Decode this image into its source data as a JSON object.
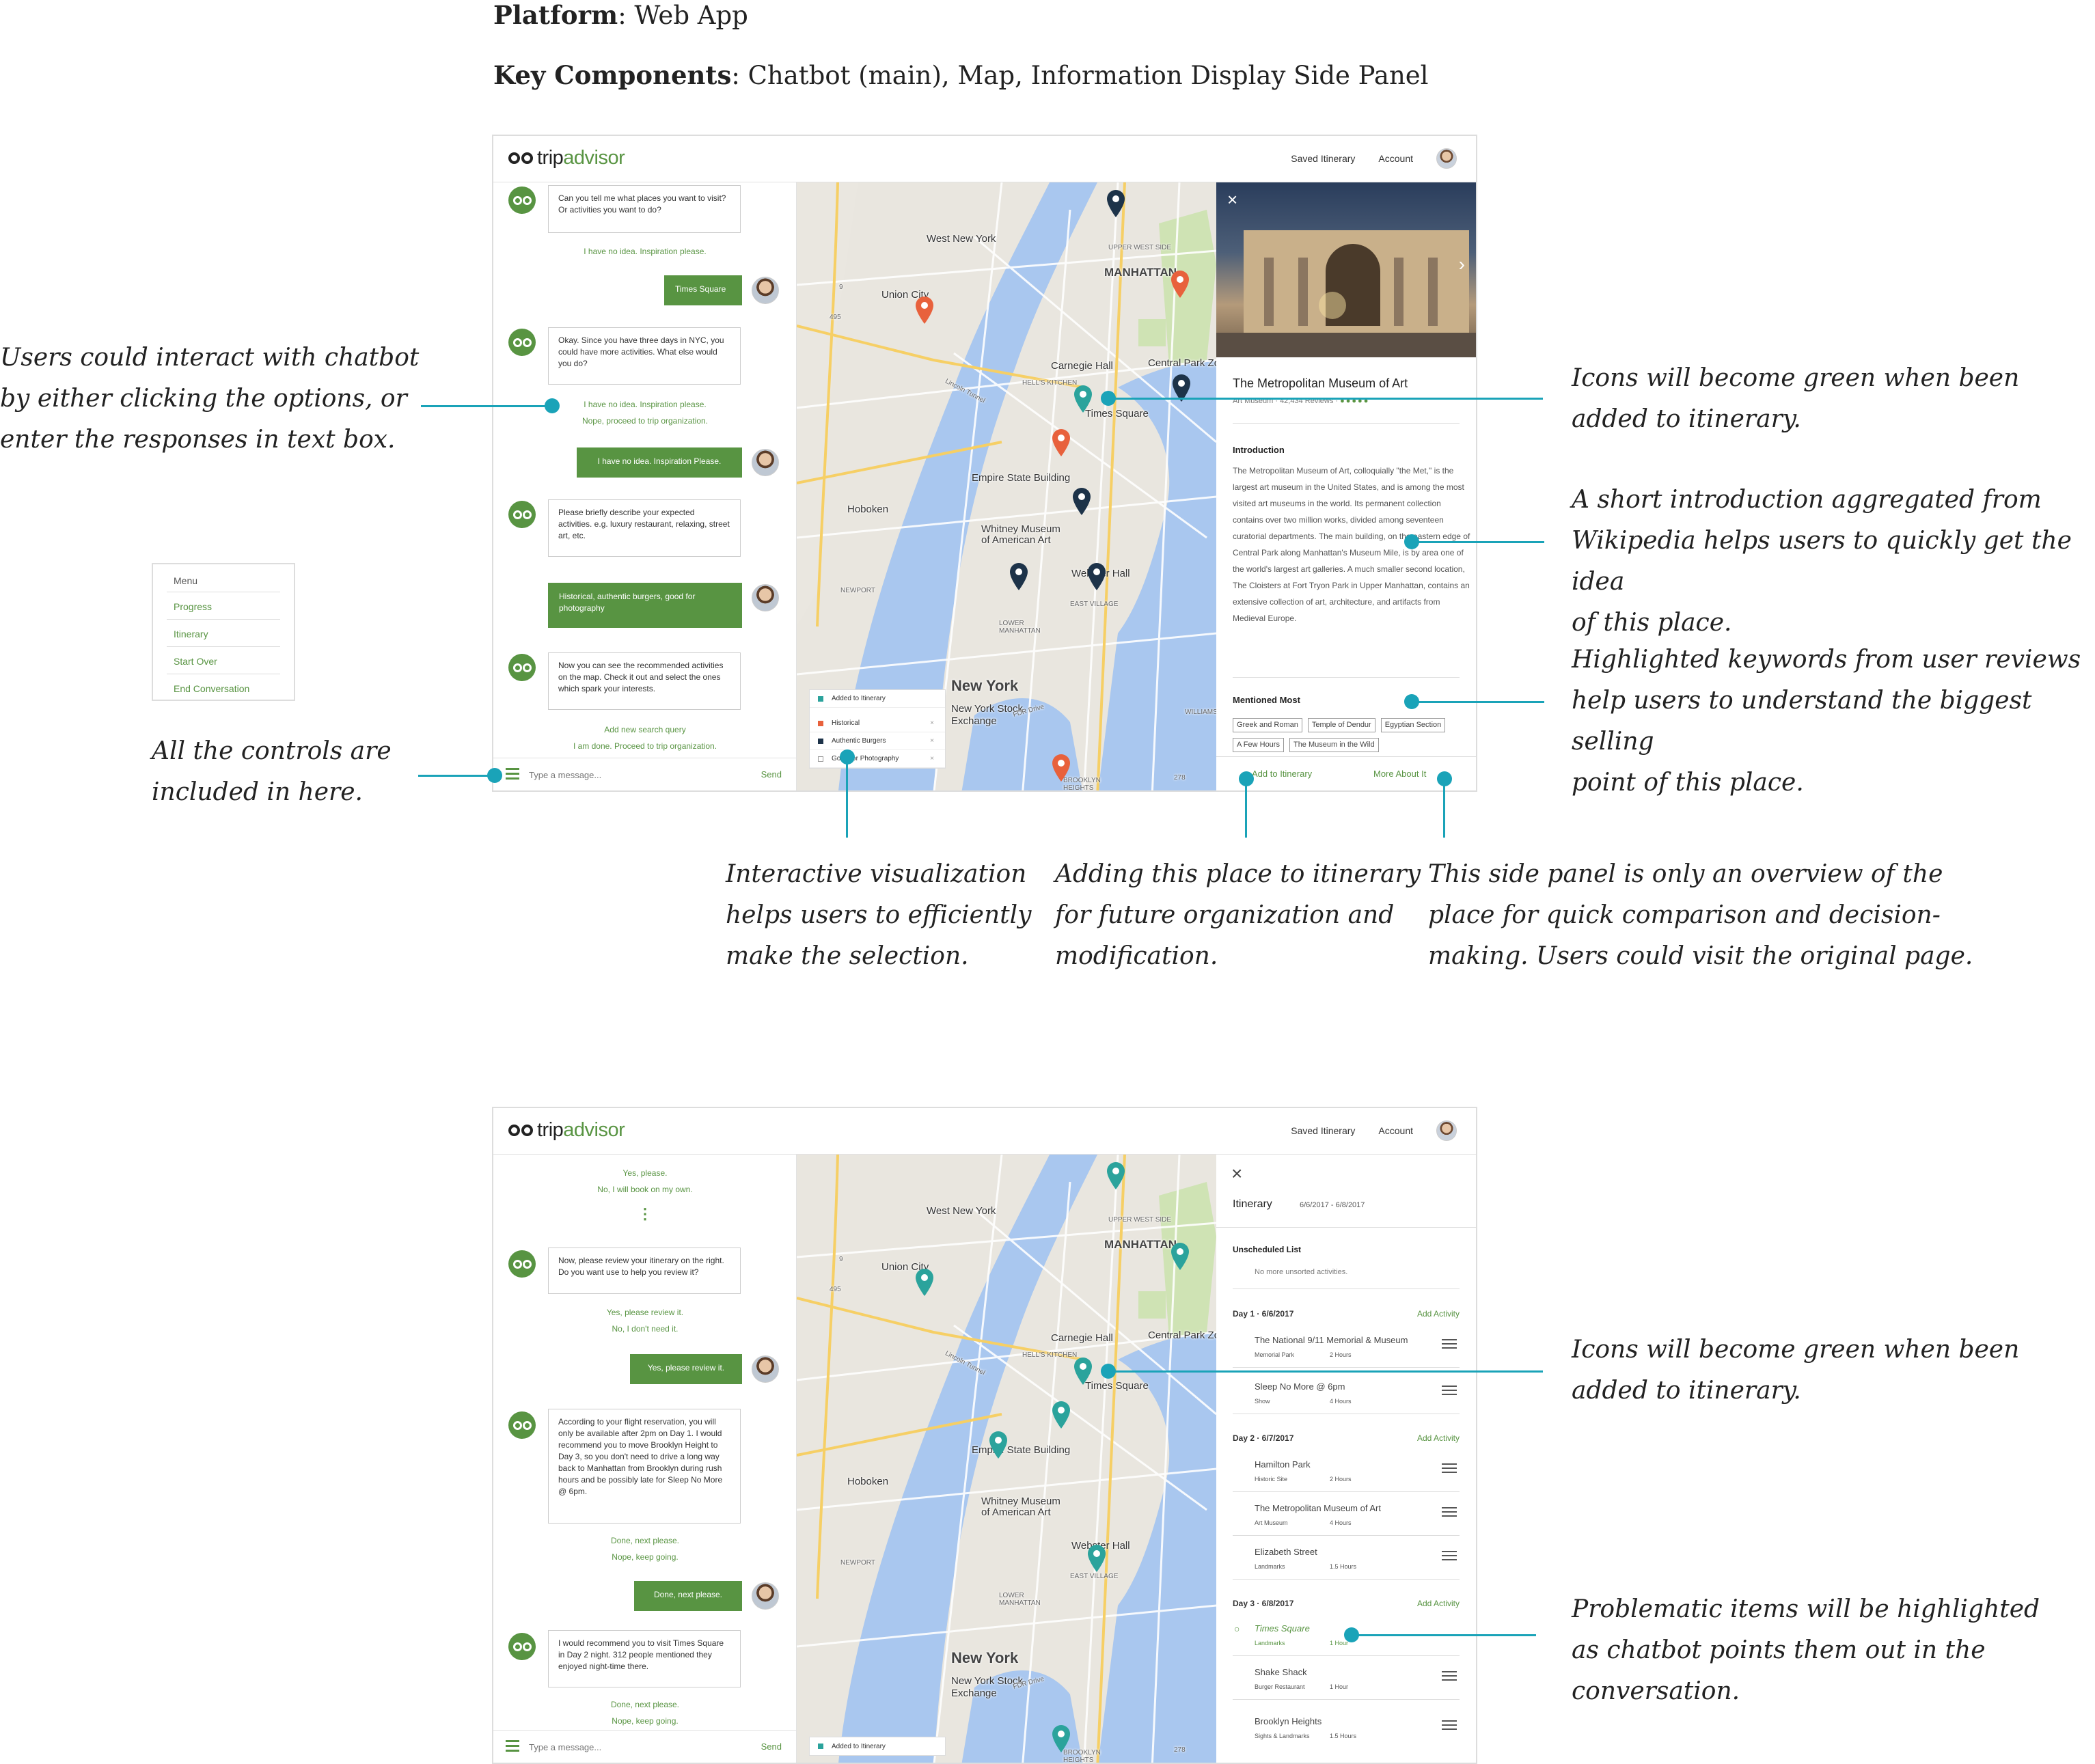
{
  "header": {
    "platform_label": "Platform",
    "platform_value": ": Web App",
    "components_label": "Key Components",
    "components_value": ": Chatbot (main), Map, Information Display Side Panel"
  },
  "annotations": {
    "chatbot": [
      "Users could interact with chatbot",
      "by either clicking the options, or",
      "enter the responses in text box."
    ],
    "controls": [
      "All the controls are",
      "included in here."
    ],
    "icons_green_1": [
      "Icons will become green when been",
      "added to itinerary."
    ],
    "intro": [
      "A short introduction aggregated from",
      "Wikipedia helps users to quickly get the idea",
      "of this place."
    ],
    "keywords": [
      "Highlighted keywords from user reviews",
      "help users to understand the biggest selling",
      "point of this place."
    ],
    "visualization": [
      "Interactive visualization",
      "helps users to efficiently",
      "make the selection."
    ],
    "adding": [
      "Adding this place to itinerary",
      "for future organization and",
      "modification."
    ],
    "overview": [
      "This side panel is only an overview of the",
      "place for quick comparison and decision-",
      "making. Users could visit the original page."
    ],
    "icons_green_2": [
      "Icons will become green when been",
      "added to itinerary."
    ],
    "problematic": [
      "Problematic items will be highlighted",
      "as chatbot points them out in the",
      "conversation."
    ]
  },
  "app": {
    "logo_prefix": "trip",
    "logo_suffix": "advisor",
    "nav": {
      "saved": "Saved Itinerary",
      "account": "Account"
    },
    "input_placeholder": "Type a message...",
    "send": "Send"
  },
  "menu": {
    "title": "Menu",
    "items": [
      "Progress",
      "Itinerary",
      "Start Over",
      "End Conversation"
    ]
  },
  "chat1": {
    "bot1": "Can you tell me what places you want to visit? Or activities you want to do?",
    "opt1": "I have no idea. Inspiration please.",
    "user1": "Times Square",
    "bot2": "Okay. Since you have three days in NYC, you could have more activities. What else would you do?",
    "opt2a": "I have no idea. Inspiration please.",
    "opt2b": "Nope, proceed to trip organization.",
    "user2": "I have no idea. Inspiration Please.",
    "bot3": "Please briefly describe your expected activities. e.g. luxury restaurant, relaxing, street art, etc.",
    "user3": "Historical, authentic burgers, good for photography",
    "bot4": "Now you can see the recommended activities on the map. Check it out and select the ones which spark your interests.",
    "opt4a": "Add new search query",
    "opt4b": "I am done. Proceed to trip organization."
  },
  "map": {
    "labels": {
      "west_new_york": "West New York",
      "union_city": "Union City",
      "manhattan": "MANHATTAN",
      "upper_west_side": "UPPER WEST SIDE",
      "carnegie_hall": "Carnegie Hall",
      "central_park": "Central Park Zo",
      "times_square": "Times Square",
      "empire_state": "Empire State Building",
      "hoboken": "Hoboken",
      "whitney": "Whitney Museum of American Art",
      "webster_hall": "Webster Hall",
      "new_york": "New York",
      "nyse": "New York Stock Exchange",
      "hells_kitchen": "HELL'S KITCHEN",
      "east_village": "EAST VILLAGE",
      "lower_manhattan": "LOWER MANHATTAN",
      "brooklyn_heights": "BROOKLYN HEIGHTS",
      "newport": "NEWPORT",
      "lincoln_tunnel": "Lincoln Tunnel",
      "fdr_drive": "FDR Drive",
      "williamsburg": "WILLIAMSBUR",
      "road_495": "495",
      "road_9": "9",
      "road_278": "278"
    },
    "legend1": {
      "title": "Added to Itinerary",
      "rows": [
        "Historical",
        "Authentic Burgers",
        "Good for Photography"
      ],
      "colors": [
        "#e8613c",
        "#1d3349",
        "#ffffff"
      ]
    },
    "legend2": {
      "title": "Added to Itinerary"
    },
    "colors": {
      "added": "#2ba39c",
      "historical": "#e8613c",
      "burgers": "#1d3349"
    }
  },
  "side1": {
    "title": "The Metropolitan Museum of Art",
    "subtitle": "Art Museum · 42,434 Reviews ·",
    "rating_circles": 5,
    "intro_heading": "Introduction",
    "intro_text": "The Metropolitan Museum of Art, colloquially \"the Met,\" is the largest art museum in the United States, and is among the most visited art museums in the world. Its permanent collection contains over two million works, divided among seventeen curatorial departments. The main building, on the eastern edge of Central Park along Manhattan's Museum Mile, is by area one of the world's largest art galleries. A much smaller second location, The Cloisters at Fort Tryon Park in Upper Manhattan, contains an extensive collection of art, architecture, and artifacts from Medieval Europe.",
    "mentioned_heading": "Mentioned Most",
    "tags": [
      "Greek and Roman",
      "Temple of Dendur",
      "Egyptian Section",
      "A Few Hours",
      "The Museum in the Wild"
    ],
    "add": "Add to Itinerary",
    "more": "More About It"
  },
  "chat2": {
    "opt0a": "Yes, please.",
    "opt0b": "No, I will book on my own.",
    "ellipsis": "⋮",
    "bot1": "Now, please review your itinerary on the right. Do you want use to help you review it?",
    "opt1a": "Yes, please review it.",
    "opt1b": "No, I don't need it.",
    "user1": "Yes, please review it.",
    "bot2": "According to your flight reservation, you will only be available after 2pm on Day 1. I would recommend you to move Brooklyn Height to Day 3, so you don't need to drive a long way back to Manhattan from Brooklyn during rush hours and be possibly late for Sleep No More @ 6pm.",
    "opt2a": "Done, next please.",
    "opt2b": "Nope, keep going.",
    "user2": "Done, next please.",
    "bot3": "I would recommend you to visit Times Square in Day 2 night. 312 people mentioned they enjoyed night-time there.",
    "opt3a": "Done, next please.",
    "opt3b": "Nope, keep going."
  },
  "itinerary": {
    "title": "Itinerary",
    "dates": "6/6/2017 - 6/8/2017",
    "unscheduled_heading": "Unscheduled List",
    "unscheduled_empty": "No more unsorted activities.",
    "add_activity": "Add Activity",
    "days": [
      {
        "label": "Day 1 · 6/6/2017",
        "items": [
          {
            "name": "The National 9/11 Memorial & Museum",
            "category": "Memorial Park",
            "duration": "2 Hours"
          },
          {
            "name": "Sleep No More @ 6pm",
            "category": "Show",
            "duration": "4 Hours"
          }
        ]
      },
      {
        "label": "Day 2 · 6/7/2017",
        "items": [
          {
            "name": "Hamilton Park",
            "category": "Historic Site",
            "duration": "2 Hours"
          },
          {
            "name": "The Metropolitan Museum of Art",
            "category": "Art Museum",
            "duration": "4 Hours"
          },
          {
            "name": "Elizabeth Street",
            "category": "Landmarks",
            "duration": "1.5 Hours"
          }
        ]
      },
      {
        "label": "Day 3 · 6/8/2017",
        "items": [
          {
            "name": "Times Square",
            "category": "Landmarks",
            "duration": "1 Hour",
            "highlighted": true
          },
          {
            "name": "Shake Shack",
            "category": "Burger Restaurant",
            "duration": "1 Hour"
          },
          {
            "name": "Brooklyn Heights",
            "category": "Sights & Landmarks",
            "duration": "1.5 Hours"
          }
        ]
      }
    ]
  },
  "colors": {
    "accent": "#589442",
    "annotation": "#1aa3b8"
  }
}
